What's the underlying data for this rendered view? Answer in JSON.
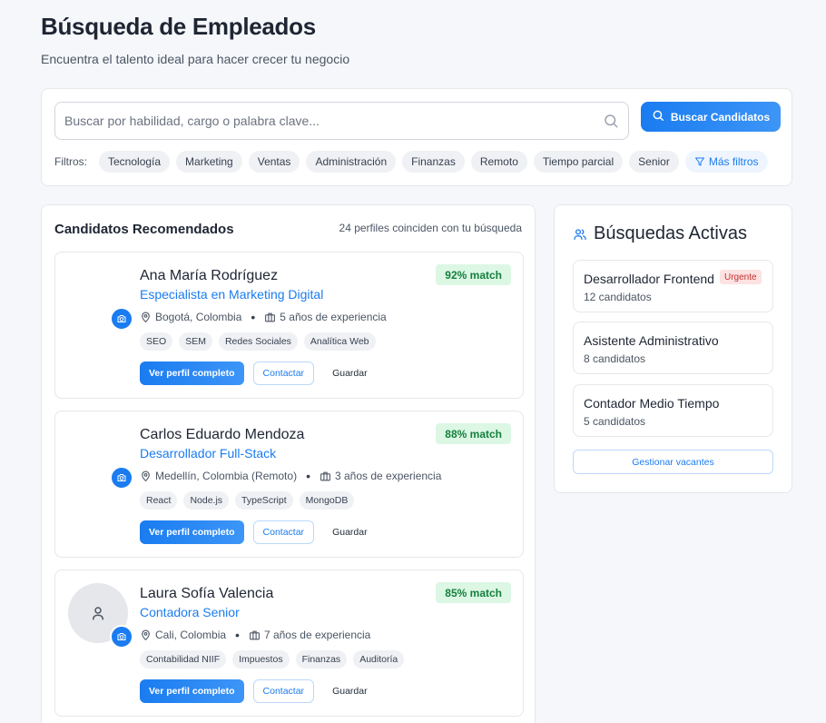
{
  "header": {
    "title": "Búsqueda de Empleados",
    "subtitle": "Encuentra el talento ideal para hacer crecer tu negocio"
  },
  "search": {
    "placeholder": "Buscar por habilidad, cargo o palabra clave...",
    "value": "",
    "button_label": "Buscar Candidatos",
    "filters_label": "Filtros:",
    "filters": [
      "Tecnología",
      "Marketing",
      "Ventas",
      "Administración",
      "Finanzas",
      "Remoto",
      "Tiempo parcial",
      "Senior"
    ],
    "more_filters_label": "Más filtros"
  },
  "candidates": {
    "title": "Candidatos Recomendados",
    "count_text": "24 perfiles coinciden con tu búsqueda",
    "items": [
      {
        "name": "Ana María Rodríguez",
        "role": "Especialista en Marketing Digital",
        "match": "92% match",
        "location": "Bogotá, Colombia",
        "experience": "5 años de experiencia",
        "skills": [
          "SEO",
          "SEM",
          "Redes Sociales",
          "Analítica Web"
        ],
        "has_avatar_bg": false
      },
      {
        "name": "Carlos Eduardo Mendoza",
        "role": "Desarrollador Full-Stack",
        "match": "88% match",
        "location": "Medellín, Colombia (Remoto)",
        "experience": "3 años de experiencia",
        "skills": [
          "React",
          "Node.js",
          "TypeScript",
          "MongoDB"
        ],
        "has_avatar_bg": false
      },
      {
        "name": "Laura Sofía Valencia",
        "role": "Contadora Senior",
        "match": "85% match",
        "location": "Cali, Colombia",
        "experience": "7 años de experiencia",
        "skills": [
          "Contabilidad NIIF",
          "Impuestos",
          "Finanzas",
          "Auditoría"
        ],
        "has_avatar_bg": true
      }
    ],
    "actions": {
      "view_profile": "Ver perfil completo",
      "contact": "Contactar",
      "save": "Guardar"
    }
  },
  "active_searches": {
    "title": "Búsquedas Activas",
    "items": [
      {
        "title": "Desarrollador Frontend",
        "count": "12 candidatos",
        "badge": "Urgente"
      },
      {
        "title": "Asistente Administrativo",
        "count": "8 candidatos",
        "badge": ""
      },
      {
        "title": "Contador Medio Tiempo",
        "count": "5 candidatos",
        "badge": ""
      }
    ],
    "manage_label": "Gestionar vacantes"
  },
  "colors": {
    "accent": "#1a7cf0",
    "match_bg": "#dcf7e4",
    "match_text": "#15803d",
    "urgent_bg": "#fde2e2",
    "urgent_text": "#c53030"
  },
  "icons": [
    "search-icon",
    "location-pin-icon",
    "briefcase-icon",
    "camera-icon",
    "user-icon",
    "users-icon",
    "filter-icon"
  ]
}
